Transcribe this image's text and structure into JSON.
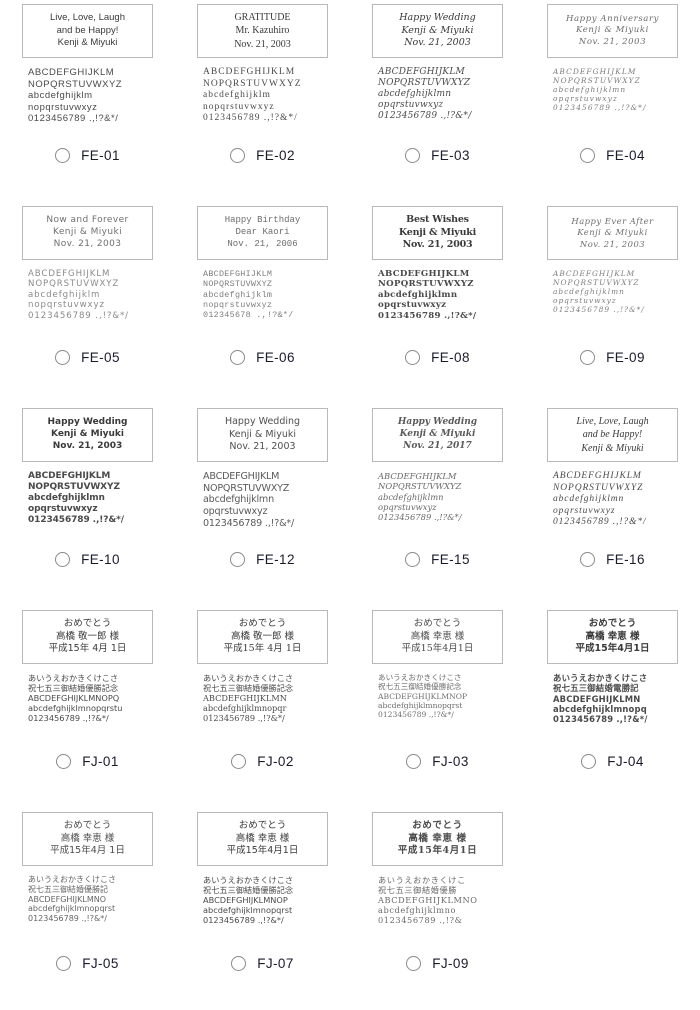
{
  "page": {
    "title": "Font selection grid",
    "radio_state": "unselected",
    "label_color": "#1b1b2e",
    "box_border_color": "#b9b9b9",
    "background": "#ffffff",
    "columns": 4
  },
  "samples": {
    "latin": [
      "ABCDEFGHIJKLM",
      "NOPQRSTUVWXYZ",
      "abcdefghijklm",
      "nopqrstuvwxyz",
      "0123456789 .,!?&*/"
    ],
    "latin_wide": [
      "ABCDEFGHIJKLM",
      "NOPQRSTUVWXYZ",
      "abcdefghijklmn",
      "opqrstuvwxyz",
      "0123456789 .,!?&*/"
    ],
    "latin_mono": [
      "ABCDEFGHIJKLM",
      "NOPQRSTUVWXYZ",
      "abcdefghijklm",
      "nopqrstuvwxyz",
      "012345678 .,!?&*/"
    ],
    "latin_compact": [
      "ABCDEFGHIJKLM",
      "NOPQRSTUVWXYZ",
      "abcdefghijklmn",
      "opqrstuvwxyz",
      "0123456789 .,!?&*/"
    ],
    "jp_a": [
      "あいうえおかきくけこさ",
      "祝七五三御結婚優勝記念",
      "ABCDEFGHIJKLMNOPQ",
      "abcdefghijklmnopqrstu",
      "0123456789 .,!?&*/"
    ],
    "jp_b": [
      "あいうえおかきくけこさ",
      "祝七五三御結婚優勝記念",
      "ABCDEFGHIJKLMN",
      "abcdefghijklmnopqr",
      "0123456789 .,!?&*/"
    ],
    "jp_c": [
      "あいうえおかきくけこさ",
      "祝七五三御結婚優勝記念",
      "ABCDEFGHIJKLMNOP",
      "abcdefghijklmnopqrst",
      "0123456789 .,!?&*/"
    ],
    "jp_d": [
      "あいうえおかきくけこさ",
      "祝七五三御結婚電勝記",
      "ABCDEFGHIJKLMN",
      "abcdefghijklmnopq",
      "0123456789 .,!?&*/"
    ],
    "jp_e": [
      "あいうえおかきくけこさ",
      "祝七五三御結婚優勝記",
      "ABCDEFGHIJKLMNO",
      "abcdefghijklmnopqrst",
      "0123456789 .,!?&*/"
    ],
    "jp_f": [
      "あいうえおかきくけこ",
      "祝七五三御結婚優勝",
      "ABCDEFGHIJKLMNO",
      "abcdefghijklmno",
      "0123456789 .,!?&"
    ]
  },
  "cells": [
    {
      "code": "FE-01",
      "style": "s-fe01",
      "sample_key": "latin",
      "preview": [
        "Live, Love, Laugh",
        "and be Happy!",
        "Kenji & Miyuki"
      ]
    },
    {
      "code": "FE-02",
      "style": "s-fe02",
      "sample_key": "latin",
      "preview": [
        "GRATITUDE",
        "Mr. Kazuhiro",
        "Nov. 21, 2003"
      ]
    },
    {
      "code": "FE-03",
      "style": "s-fe03",
      "sample_key": "latin_wide",
      "preview": [
        "Happy Wedding",
        "Kenji & Miyuki",
        "Nov. 21, 2003"
      ]
    },
    {
      "code": "FE-04",
      "style": "s-fe04",
      "sample_key": "latin_wide",
      "preview": [
        "Happy Anniversary",
        "Kenji & Miyuki",
        "Nov. 21, 2003"
      ]
    },
    {
      "code": "FE-05",
      "style": "s-fe05",
      "sample_key": "latin",
      "preview": [
        "Now and Forever",
        "Kenji & Miyuki",
        "Nov. 21, 2003"
      ]
    },
    {
      "code": "FE-06",
      "style": "s-fe06",
      "sample_key": "latin_mono",
      "preview": [
        "Happy Birthday",
        "Dear Kaori",
        "Nov. 21, 2006"
      ]
    },
    {
      "code": "FE-08",
      "style": "s-fe08",
      "sample_key": "latin_wide",
      "preview": [
        "Best Wishes",
        "Kenji & Miyuki",
        "Nov. 21, 2003"
      ]
    },
    {
      "code": "FE-09",
      "style": "s-fe09",
      "sample_key": "latin_wide",
      "preview": [
        "Happy Ever After",
        "Kenji & Miyuki",
        "Nov. 21, 2003"
      ]
    },
    {
      "code": "FE-10",
      "style": "s-fe10",
      "sample_key": "latin_compact",
      "preview": [
        "Happy Wedding",
        "Kenji & Miyuki",
        "Nov. 21, 2003"
      ]
    },
    {
      "code": "FE-12",
      "style": "s-fe12",
      "sample_key": "latin_compact",
      "preview": [
        "Happy Wedding",
        "Kenji & Miyuki",
        "Nov. 21, 2003"
      ]
    },
    {
      "code": "FE-15",
      "style": "s-fe15",
      "sample_key": "latin_compact",
      "preview": [
        "Happy Wedding",
        "Kenji & Miyuki",
        "Nov. 21, 2017"
      ]
    },
    {
      "code": "FE-16",
      "style": "s-fe16",
      "sample_key": "latin_wide",
      "preview": [
        "Live, Love, Laugh",
        "and be Happy!",
        "Kenji & Miyuki"
      ]
    },
    {
      "code": "FJ-01",
      "style": "s-fj01",
      "sample_key": "jp_a",
      "preview": [
        "おめでとう",
        "高橋 敬一郎 様",
        "平成15年 4月 1日"
      ]
    },
    {
      "code": "FJ-02",
      "style": "s-fj02",
      "sample_key": "jp_b",
      "preview": [
        "おめでとう",
        "高橋 敬一郎 様",
        "平成15年 4月 1日"
      ]
    },
    {
      "code": "FJ-03",
      "style": "s-fj03",
      "sample_key": "jp_c",
      "preview": [
        "おめでとう",
        "高橋 幸恵 様",
        "平成15年4月1日"
      ]
    },
    {
      "code": "FJ-04",
      "style": "s-fj04",
      "sample_key": "jp_d",
      "preview": [
        "おめでとう",
        "高橋 幸恵 様",
        "平成15年4月1日"
      ]
    },
    {
      "code": "FJ-05",
      "style": "s-fj05",
      "sample_key": "jp_e",
      "preview": [
        "おめでとう",
        "高橋 幸恵 様",
        "平成15年4月 1日"
      ]
    },
    {
      "code": "FJ-07",
      "style": "s-fj07",
      "sample_key": "jp_c",
      "preview": [
        "おめでとう",
        "高橋 幸恵 様",
        "平成15年4月1日"
      ]
    },
    {
      "code": "FJ-09",
      "style": "s-fj09",
      "sample_key": "jp_f",
      "preview": [
        "おめでとう",
        "高橋 幸恵 様",
        "平成15年4月1日"
      ]
    }
  ]
}
